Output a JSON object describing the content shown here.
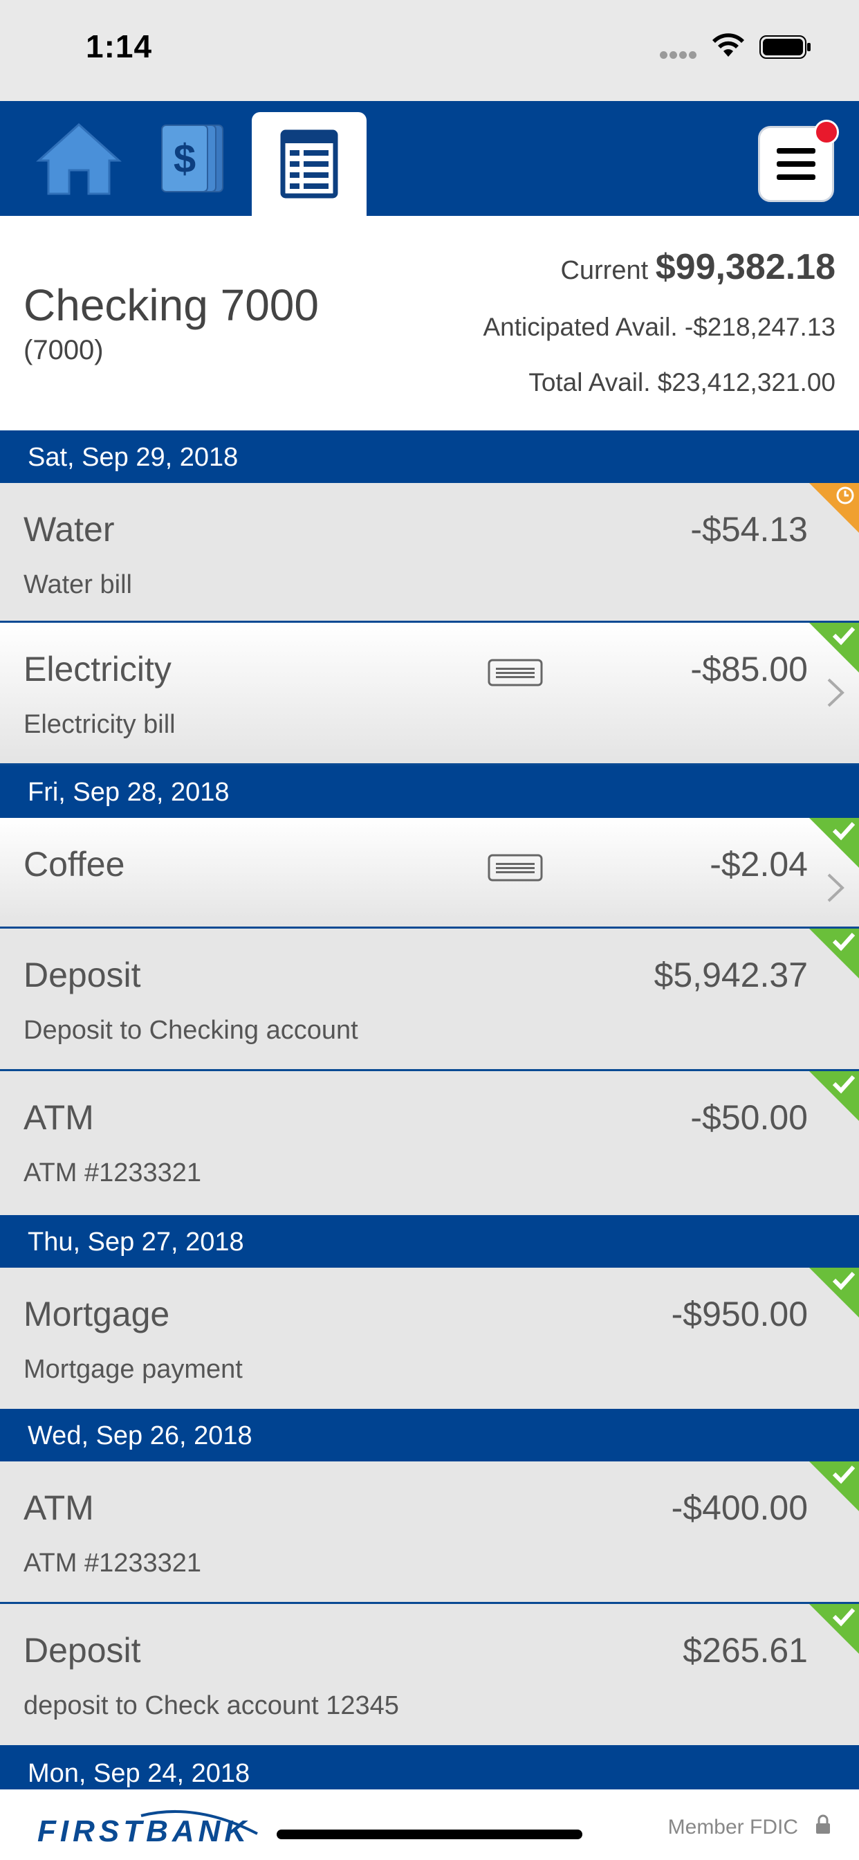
{
  "status_bar": {
    "time": "1:14"
  },
  "nav": {
    "tabs": [
      {
        "name": "home-icon"
      },
      {
        "name": "dollar-cards-icon"
      },
      {
        "name": "ledger-icon"
      }
    ],
    "menu_icon": "hamburger-menu-icon"
  },
  "account": {
    "name": "Checking 7000",
    "number": "(7000)",
    "current_label": "Current",
    "current_amount": "$99,382.18",
    "anticipated_label": "Anticipated Avail.",
    "anticipated_amount": "-$218,247.13",
    "total_label": "Total Avail.",
    "total_amount": "$23,412,321.00"
  },
  "dates": [
    "Sat, Sep 29, 2018",
    "Fri, Sep 28, 2018",
    "Thu, Sep 27, 2018",
    "Wed, Sep 26, 2018",
    "Mon, Sep 24, 2018"
  ],
  "transactions": [
    {
      "title": "Water",
      "description": "Water bill",
      "amount": "-$54.13",
      "status": "pending"
    },
    {
      "title": "Electricity",
      "description": "Electricity bill",
      "amount": "-$85.00",
      "status": "cleared"
    },
    {
      "title": "Coffee",
      "description": "",
      "amount": "-$2.04",
      "status": "cleared"
    },
    {
      "title": "Deposit",
      "description": "Deposit to Checking account",
      "amount": "$5,942.37",
      "status": "cleared"
    },
    {
      "title": "ATM",
      "description": "ATM #1233321",
      "amount": "-$50.00",
      "status": "cleared"
    },
    {
      "title": "Mortgage",
      "description": "Mortgage payment",
      "amount": "-$950.00",
      "status": "cleared"
    },
    {
      "title": "ATM",
      "description": "ATM #1233321",
      "amount": "-$400.00",
      "status": "cleared"
    },
    {
      "title": "Deposit",
      "description": "deposit to Check account 12345",
      "amount": "$265.61",
      "status": "cleared"
    }
  ],
  "colors": {
    "brand_blue": "#004391",
    "pending_orange": "#f0a030",
    "cleared_green": "#6abf3a"
  },
  "footer": {
    "logo": "FIRSTBANK",
    "fdic": "Member FDIC"
  }
}
